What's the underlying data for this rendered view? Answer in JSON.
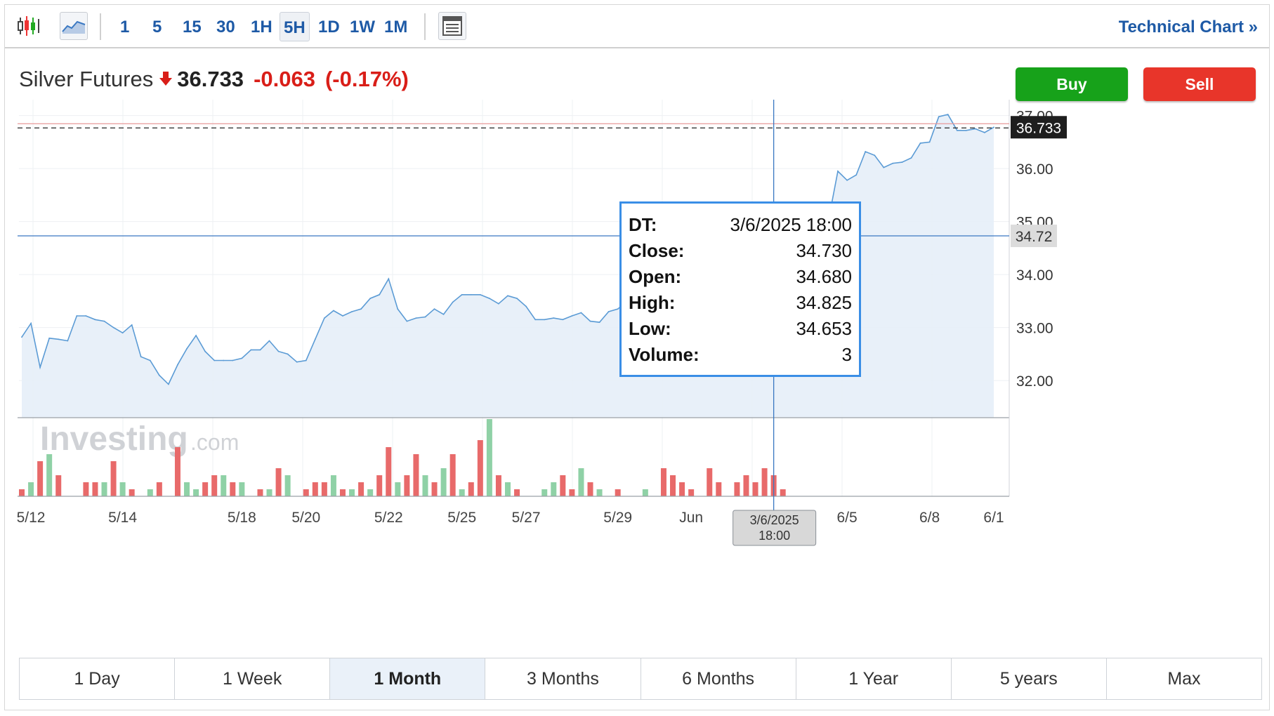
{
  "toolbar": {
    "timeframes": [
      "1",
      "5",
      "15",
      "30",
      "1H",
      "5H",
      "1D",
      "1W",
      "1M"
    ],
    "active_timeframe": "5H",
    "technical_link": "Technical Chart",
    "technical_arrow": "»",
    "icons": [
      "candlestick-icon",
      "line-chart-icon",
      "layout-icon"
    ]
  },
  "header": {
    "instrument": "Silver Futures",
    "price": "36.733",
    "change": "-0.063",
    "change_pct": "(-0.17%)",
    "direction_icon": "down-arrow-icon",
    "buy_label": "Buy",
    "sell_label": "Sell"
  },
  "colors": {
    "up": "#8fd1a6",
    "down": "#e86a6a",
    "line": "#5b9bd5",
    "area": "#e6eef8",
    "accent": "#1e5aa6",
    "buy": "#17a21a",
    "sell": "#e8352a"
  },
  "crosshair": {
    "price_label": "34.72",
    "date_line1": "3/6/2025",
    "date_line2": "18:00",
    "current_price_label": "36.733"
  },
  "tooltip": {
    "rows": [
      {
        "key": "DT:",
        "value": "3/6/2025 18:00"
      },
      {
        "key": "Close:",
        "value": "34.730"
      },
      {
        "key": "Open:",
        "value": "34.680"
      },
      {
        "key": "High:",
        "value": "34.825"
      },
      {
        "key": "Low:",
        "value": "34.653"
      },
      {
        "key": "Volume:",
        "value": "3"
      }
    ]
  },
  "watermark": {
    "main": "Investing",
    "suffix": ".com"
  },
  "ranges": [
    "1 Day",
    "1 Week",
    "1 Month",
    "3 Months",
    "6 Months",
    "1 Year",
    "5 years",
    "Max"
  ],
  "active_range": "1 Month",
  "chart_data": {
    "type": "area",
    "title": "Silver Futures",
    "ylim": [
      31.3,
      37.3
    ],
    "yticks": [
      "37.00",
      "36.00",
      "35.00",
      "34.00",
      "33.00",
      "32.00"
    ],
    "ytick_values": [
      37,
      36,
      35,
      34,
      33,
      32
    ],
    "xtick_labels": [
      "5/12",
      "5/14",
      "5/18",
      "5/20",
      "5/22",
      "5/25",
      "5/27",
      "5/29",
      "Jun",
      "6/5",
      "6/8",
      "6/1"
    ],
    "xtick_index": [
      1,
      11,
      24,
      31,
      40,
      48,
      55,
      65,
      73,
      90,
      99,
      109
    ],
    "grid": true,
    "series": [
      {
        "values": [
          32.82,
          33.08,
          32.25,
          32.8,
          32.78,
          32.75,
          33.22,
          33.22,
          33.15,
          33.12,
          33.0,
          32.9,
          33.05,
          32.45,
          32.38,
          32.1,
          31.93,
          32.3,
          32.6,
          32.85,
          32.55,
          32.38,
          32.38,
          32.38,
          32.42,
          32.58,
          32.58,
          32.75,
          32.55,
          32.5,
          32.35,
          32.38,
          32.78,
          33.18,
          33.32,
          33.22,
          33.3,
          33.35,
          33.55,
          33.62,
          33.92,
          33.35,
          33.12,
          33.18,
          33.2,
          33.35,
          33.25,
          33.48,
          33.62,
          33.62,
          33.62,
          33.55,
          33.45,
          33.6,
          33.55,
          33.4,
          33.15,
          33.15,
          33.18,
          33.15,
          33.22,
          33.28,
          33.12,
          33.1,
          33.3,
          33.35,
          33.5,
          33.48,
          33.45,
          33.15,
          33.18,
          33.32,
          33.0,
          33.08,
          33.25,
          33.32,
          33.72,
          34.05,
          34.3,
          34.42,
          34.58,
          34.68,
          34.73,
          34.58,
          34.5,
          34.65,
          34.63,
          34.68,
          35.05,
          35.95,
          35.78,
          35.88,
          36.32,
          36.25,
          36.02,
          36.1,
          36.12,
          36.2,
          36.48,
          36.5,
          36.98,
          37.02,
          36.72,
          36.72,
          36.75,
          36.68,
          36.78
        ],
        "volume": [
          1,
          2,
          5,
          6,
          3,
          0,
          0,
          2,
          2,
          2,
          5,
          2,
          1,
          0,
          1,
          2,
          0,
          7,
          2,
          1,
          2,
          3,
          3,
          2,
          2,
          0,
          1,
          1,
          4,
          3,
          0,
          1,
          2,
          2,
          3,
          1,
          1,
          2,
          1,
          3,
          7,
          2,
          3,
          6,
          3,
          2,
          4,
          6,
          1,
          2,
          8,
          11,
          3,
          2,
          1,
          0,
          0,
          1,
          2,
          3,
          1,
          4,
          2,
          1,
          0,
          1,
          0,
          0,
          1,
          0,
          4,
          3,
          2,
          1,
          0,
          4,
          2,
          0,
          2,
          3,
          2,
          4,
          3,
          1,
          0,
          0,
          0,
          0,
          0,
          0,
          0,
          0,
          0,
          0,
          0,
          0,
          0,
          0,
          0,
          0,
          0,
          0,
          0,
          0,
          0,
          0,
          0,
          0,
          0,
          0,
          0,
          0,
          0,
          0,
          0,
          0,
          0,
          0,
          0,
          0,
          0,
          0,
          0,
          0,
          0,
          0,
          0,
          0,
          0,
          0,
          0,
          0,
          0,
          0,
          0,
          0,
          0,
          0,
          0,
          0,
          0,
          0,
          0,
          0,
          0,
          0,
          0,
          0,
          0,
          0,
          0,
          0,
          0,
          0,
          0,
          0,
          0,
          0,
          0,
          0,
          0,
          0,
          0,
          0,
          0,
          0,
          0,
          0,
          0,
          0,
          0,
          0,
          0,
          0,
          0,
          0,
          0,
          0,
          0,
          0,
          0,
          0,
          0,
          0,
          0,
          0,
          0,
          0,
          0,
          0,
          0,
          0,
          0,
          0,
          0,
          0,
          0,
          0,
          0,
          0,
          0,
          0,
          0,
          0,
          0,
          0,
          0,
          0,
          0
        ],
        "volume_up": [
          false,
          true,
          false,
          true,
          false,
          true,
          true,
          false,
          false,
          true,
          false,
          true,
          false,
          true,
          true,
          false,
          false,
          false,
          true,
          true,
          false,
          false,
          true,
          false,
          true,
          true,
          false,
          true,
          false,
          true,
          true,
          false,
          false,
          false,
          true,
          false,
          true,
          false,
          true,
          false,
          false,
          true,
          false,
          false,
          true,
          false,
          true,
          false,
          true,
          false,
          false,
          true,
          false,
          true,
          false,
          true,
          false,
          true,
          true,
          false,
          false,
          true,
          false,
          true,
          true,
          false,
          true,
          false,
          true,
          false,
          false,
          false,
          false,
          false,
          false,
          false,
          false,
          false,
          false,
          false,
          false,
          false,
          false,
          false,
          false,
          false,
          false,
          false,
          false,
          true,
          false,
          false,
          false,
          false,
          false,
          false,
          false,
          false,
          false,
          false,
          false,
          false,
          false,
          false,
          false,
          false,
          false
        ]
      }
    ]
  }
}
